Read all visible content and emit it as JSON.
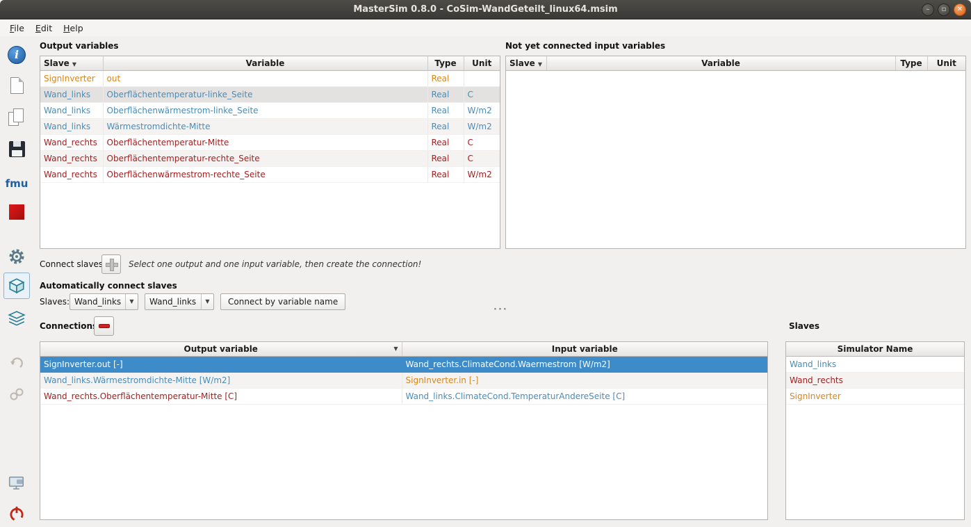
{
  "window": {
    "title": "MasterSim 0.8.0 - CoSim-WandGeteilt_linux64.msim",
    "controls": {
      "minimize": "–",
      "maximize": "▫",
      "close": "✕"
    }
  },
  "menu": {
    "items": [
      {
        "label": "File"
      },
      {
        "label": "Edit"
      },
      {
        "label": "Help"
      }
    ]
  },
  "sidebar": {
    "fmu_label": "fmu",
    "icons": [
      "about-icon",
      "new-project-icon",
      "open-project-icon",
      "save-project-icon",
      "fmu-icon",
      "logo-icon",
      "simulation-settings-icon",
      "slaves-view-icon",
      "connections-view-icon",
      "undo-icon",
      "link-icon",
      "feedback-icon",
      "power-icon"
    ],
    "selected_tool": "slaves-view-icon"
  },
  "colors": {
    "selection_active": "#3d8bc9",
    "selection_inactive": "#e3e2e0",
    "slave_orange": "#d9861c",
    "slave_blue": "#4a8cb8",
    "slave_red": "#a32020"
  },
  "output_variables": {
    "title": "Output variables",
    "columns": [
      "Slave",
      "Variable",
      "Type",
      "Unit"
    ],
    "rows": [
      {
        "slave": "SignInverter",
        "variable": "out",
        "type": "Real",
        "unit": "",
        "color": "orange",
        "selected": false
      },
      {
        "slave": "Wand_links",
        "variable": "Oberflächentemperatur-linke_Seite",
        "type": "Real",
        "unit": "C",
        "color": "blue",
        "selected": true
      },
      {
        "slave": "Wand_links",
        "variable": "Oberflächenwärmestrom-linke_Seite",
        "type": "Real",
        "unit": "W/m2",
        "color": "blue",
        "selected": false
      },
      {
        "slave": "Wand_links",
        "variable": "Wärmestromdichte-Mitte",
        "type": "Real",
        "unit": "W/m2",
        "color": "blue",
        "selected": false
      },
      {
        "slave": "Wand_rechts",
        "variable": "Oberflächentemperatur-Mitte",
        "type": "Real",
        "unit": "C",
        "color": "red",
        "selected": false
      },
      {
        "slave": "Wand_rechts",
        "variable": "Oberflächentemperatur-rechte_Seite",
        "type": "Real",
        "unit": "C",
        "color": "red",
        "selected": false
      },
      {
        "slave": "Wand_rechts",
        "variable": "Oberflächenwärmestrom-rechte_Seite",
        "type": "Real",
        "unit": "W/m2",
        "color": "red",
        "selected": false
      }
    ]
  },
  "input_variables": {
    "title": "Not yet connected input variables",
    "columns": [
      "Slave",
      "Variable",
      "Type",
      "Unit"
    ],
    "rows": []
  },
  "connect_slaves": {
    "label": "Connect slaves",
    "hint": "Select one output and one input variable, then create the connection!"
  },
  "auto_connect": {
    "title": "Automatically connect slaves",
    "slaves_label": "Slaves:",
    "combo1": "Wand_links",
    "combo2": "Wand_links",
    "button_label": "Connect by variable name"
  },
  "connections": {
    "title": "Connections",
    "columns": [
      "Output variable",
      "Input variable"
    ],
    "rows": [
      {
        "output": "SignInverter.out [-]",
        "input": "Wand_rechts.ClimateCond.Waermestrom [W/m2]",
        "output_color": "white",
        "input_color": "white",
        "selected": true
      },
      {
        "output": "Wand_links.Wärmestromdichte-Mitte [W/m2]",
        "input": "SignInverter.in [-]",
        "output_color": "blue",
        "input_color": "orange",
        "selected": false
      },
      {
        "output": "Wand_rechts.Oberflächentemperatur-Mitte [C]",
        "input": "Wand_links.ClimateCond.TemperaturAndereSeite [C]",
        "output_color": "red",
        "input_color": "blue",
        "selected": false
      }
    ]
  },
  "slaves_panel": {
    "title": "Slaves",
    "columns": [
      "Simulator Name"
    ],
    "rows": [
      {
        "name": "Wand_links",
        "color": "blue"
      },
      {
        "name": "Wand_rechts",
        "color": "red"
      },
      {
        "name": "SignInverter",
        "color": "orange"
      }
    ]
  }
}
